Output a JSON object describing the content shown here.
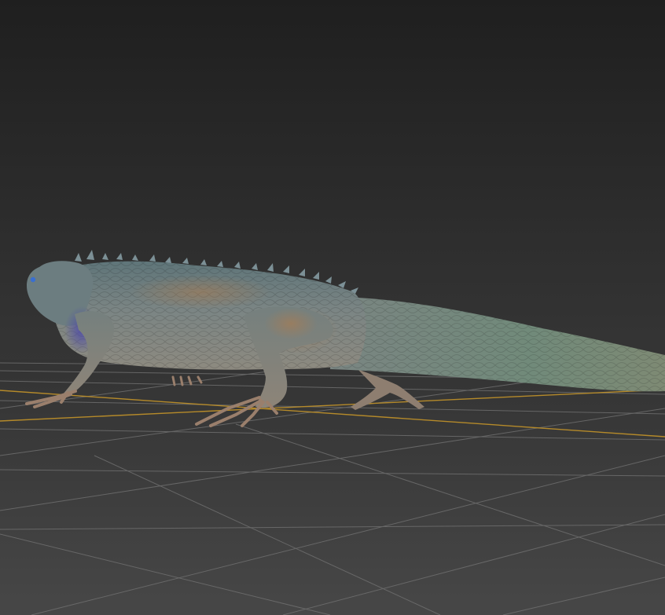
{
  "viewport": {
    "kind": "3d-perspective-viewport",
    "background_top_color": "#1f1f1f",
    "background_bottom_color": "#3d3d3d",
    "floor_color": "#3e3e3e",
    "grid_color": "#6e6e6e",
    "axis_grid_color": "#b58a2a"
  },
  "model": {
    "subject": "iguana-sculpt",
    "body_color": "#6f7f80",
    "belly_color": "#8a8a7e",
    "accent_orange": "#b07a4a",
    "accent_green": "#6b8f74",
    "accent_blue": "#4d4aa8",
    "claw_color": "#9a7f6c"
  }
}
